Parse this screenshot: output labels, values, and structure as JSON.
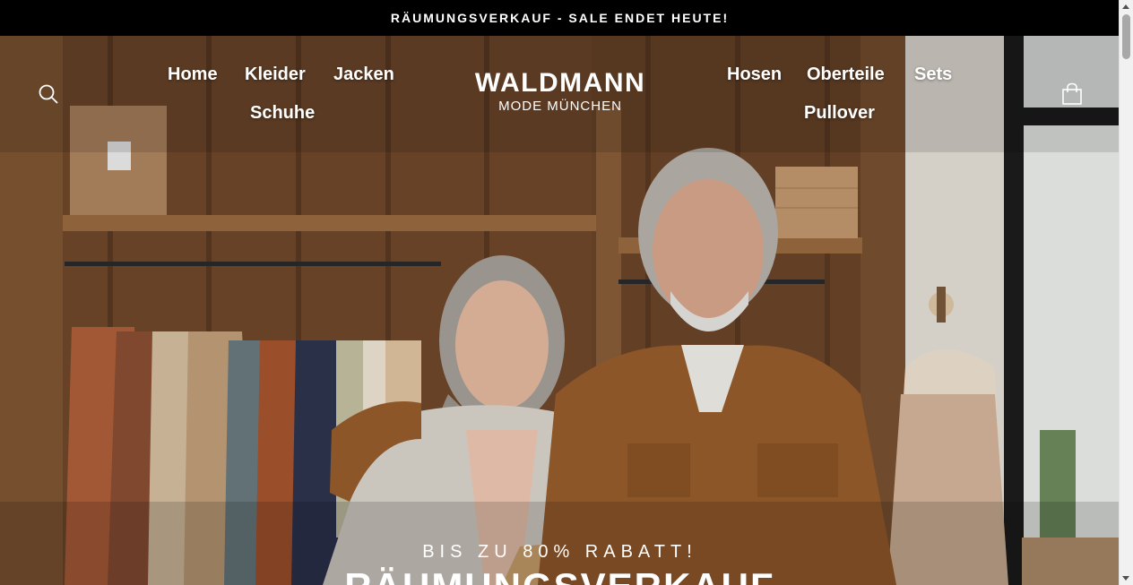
{
  "announcement": "RÄUMUNGSVERKAUF - SALE ENDET HEUTE!",
  "header": {
    "nav_left": [
      "Home",
      "Kleider",
      "Jacken",
      "Schuhe"
    ],
    "nav_right": [
      "Hosen",
      "Oberteile",
      "Sets",
      "Pullover"
    ],
    "logo": {
      "name": "WALDMANN",
      "tagline": "MODE MÜNCHEN"
    },
    "icons": {
      "search": "search-icon",
      "cart": "shopping-bag-icon"
    }
  },
  "hero": {
    "kicker": "BIS ZU 80% RABATT!",
    "title": "RÄUMUNGSVERKAUF"
  },
  "colors": {
    "announcement_bg": "#000000",
    "text": "#ffffff"
  }
}
